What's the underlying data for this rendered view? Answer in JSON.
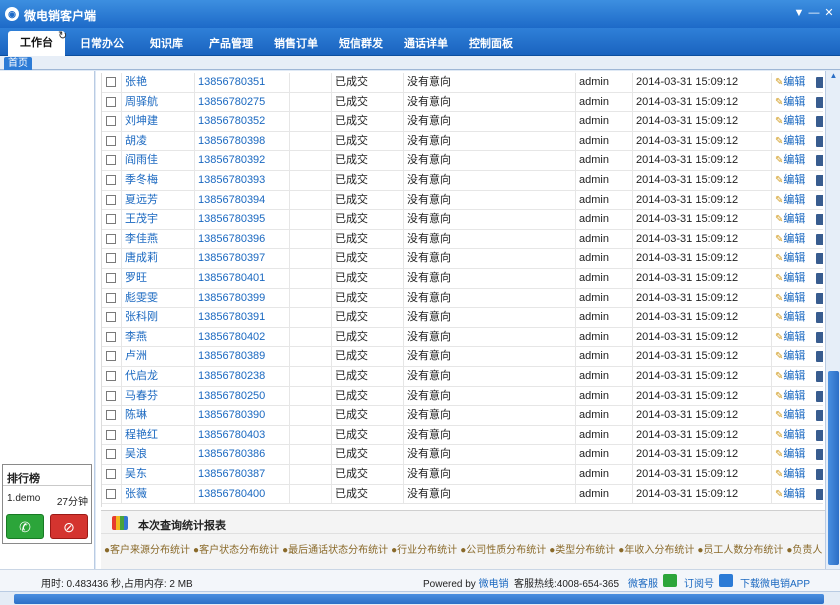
{
  "window": {
    "title": "微电销客户端",
    "icon": "logo-icon",
    "controls": [
      "▼",
      "—",
      "✕"
    ]
  },
  "nav": {
    "tabs": [
      {
        "label": "工作台",
        "active": true
      },
      {
        "label": "日常办公"
      },
      {
        "label": "知识库"
      },
      {
        "label": "产品管理"
      },
      {
        "label": "销售订单"
      },
      {
        "label": "短信群发"
      },
      {
        "label": "通话详单"
      },
      {
        "label": "控制面板"
      }
    ]
  },
  "page_tab": "首页",
  "records": [
    {
      "name": "张艳",
      "phone": "13856780351",
      "status": "已成交",
      "intent": "没有意向",
      "user": "admin",
      "time": "2014-03-31 15:09:12",
      "edit": "编辑"
    },
    {
      "name": "周驿航",
      "phone": "13856780275",
      "status": "已成交",
      "intent": "没有意向",
      "user": "admin",
      "time": "2014-03-31 15:09:12",
      "edit": "编辑"
    },
    {
      "name": "刘坤建",
      "phone": "13856780352",
      "status": "已成交",
      "intent": "没有意向",
      "user": "admin",
      "time": "2014-03-31 15:09:12",
      "edit": "编辑"
    },
    {
      "name": "胡凌",
      "phone": "13856780398",
      "status": "已成交",
      "intent": "没有意向",
      "user": "admin",
      "time": "2014-03-31 15:09:12",
      "edit": "编辑"
    },
    {
      "name": "阎雨佳",
      "phone": "13856780392",
      "status": "已成交",
      "intent": "没有意向",
      "user": "admin",
      "time": "2014-03-31 15:09:12",
      "edit": "编辑"
    },
    {
      "name": "季冬梅",
      "phone": "13856780393",
      "status": "已成交",
      "intent": "没有意向",
      "user": "admin",
      "time": "2014-03-31 15:09:12",
      "edit": "编辑"
    },
    {
      "name": "夏远芳",
      "phone": "13856780394",
      "status": "已成交",
      "intent": "没有意向",
      "user": "admin",
      "time": "2014-03-31 15:09:12",
      "edit": "编辑"
    },
    {
      "name": "王茂宇",
      "phone": "13856780395",
      "status": "已成交",
      "intent": "没有意向",
      "user": "admin",
      "time": "2014-03-31 15:09:12",
      "edit": "编辑"
    },
    {
      "name": "李佳燕",
      "phone": "13856780396",
      "status": "已成交",
      "intent": "没有意向",
      "user": "admin",
      "time": "2014-03-31 15:09:12",
      "edit": "编辑"
    },
    {
      "name": "唐成莉",
      "phone": "13856780397",
      "status": "已成交",
      "intent": "没有意向",
      "user": "admin",
      "time": "2014-03-31 15:09:12",
      "edit": "编辑"
    },
    {
      "name": "罗旺",
      "phone": "13856780401",
      "status": "已成交",
      "intent": "没有意向",
      "user": "admin",
      "time": "2014-03-31 15:09:12",
      "edit": "编辑"
    },
    {
      "name": "彪雯雯",
      "phone": "13856780399",
      "status": "已成交",
      "intent": "没有意向",
      "user": "admin",
      "time": "2014-03-31 15:09:12",
      "edit": "编辑"
    },
    {
      "name": "张科刚",
      "phone": "13856780391",
      "status": "已成交",
      "intent": "没有意向",
      "user": "admin",
      "time": "2014-03-31 15:09:12",
      "edit": "编辑"
    },
    {
      "name": "李燕",
      "phone": "13856780402",
      "status": "已成交",
      "intent": "没有意向",
      "user": "admin",
      "time": "2014-03-31 15:09:12",
      "edit": "编辑"
    },
    {
      "name": "卢洲",
      "phone": "13856780389",
      "status": "已成交",
      "intent": "没有意向",
      "user": "admin",
      "time": "2014-03-31 15:09:12",
      "edit": "编辑"
    },
    {
      "name": "代启龙",
      "phone": "13856780238",
      "status": "已成交",
      "intent": "没有意向",
      "user": "admin",
      "time": "2014-03-31 15:09:12",
      "edit": "编辑"
    },
    {
      "name": "马春芬",
      "phone": "13856780250",
      "status": "已成交",
      "intent": "没有意向",
      "user": "admin",
      "time": "2014-03-31 15:09:12",
      "edit": "编辑"
    },
    {
      "name": "陈琳",
      "phone": "13856780390",
      "status": "已成交",
      "intent": "没有意向",
      "user": "admin",
      "time": "2014-03-31 15:09:12",
      "edit": "编辑"
    },
    {
      "name": "程艳红",
      "phone": "13856780403",
      "status": "已成交",
      "intent": "没有意向",
      "user": "admin",
      "time": "2014-03-31 15:09:12",
      "edit": "编辑"
    },
    {
      "name": "吴浪",
      "phone": "13856780386",
      "status": "已成交",
      "intent": "没有意向",
      "user": "admin",
      "time": "2014-03-31 15:09:12",
      "edit": "编辑"
    },
    {
      "name": "吴东",
      "phone": "13856780387",
      "status": "已成交",
      "intent": "没有意向",
      "user": "admin",
      "time": "2014-03-31 15:09:12",
      "edit": "编辑"
    },
    {
      "name": "张薇",
      "phone": "13856780400",
      "status": "已成交",
      "intent": "没有意向",
      "user": "admin",
      "time": "2014-03-31 15:09:12",
      "edit": "编辑"
    }
  ],
  "ranking": {
    "title": "排行榜",
    "entry_user": "1.demo",
    "entry_time": "27分钟"
  },
  "report": {
    "title": "本次查询统计报表",
    "links": [
      "●客户来源分布统计",
      "●客户状态分布统计",
      "●最后通话状态分布统计",
      "●行业分布统计",
      "●公司性质分布统计",
      "●类型分布统计",
      "●年收入分布统计",
      "●员工人数分布统计",
      "●负责人"
    ]
  },
  "status": {
    "timing": "用时: 0.483436 秒,占用内存: 2 MB",
    "powered_prefix": "Powered by",
    "brand": "微电销",
    "hotline": "客服热线:4008-654-365",
    "service": "微客服",
    "subscribe": "订阅号",
    "download": "下载微电销APP"
  }
}
